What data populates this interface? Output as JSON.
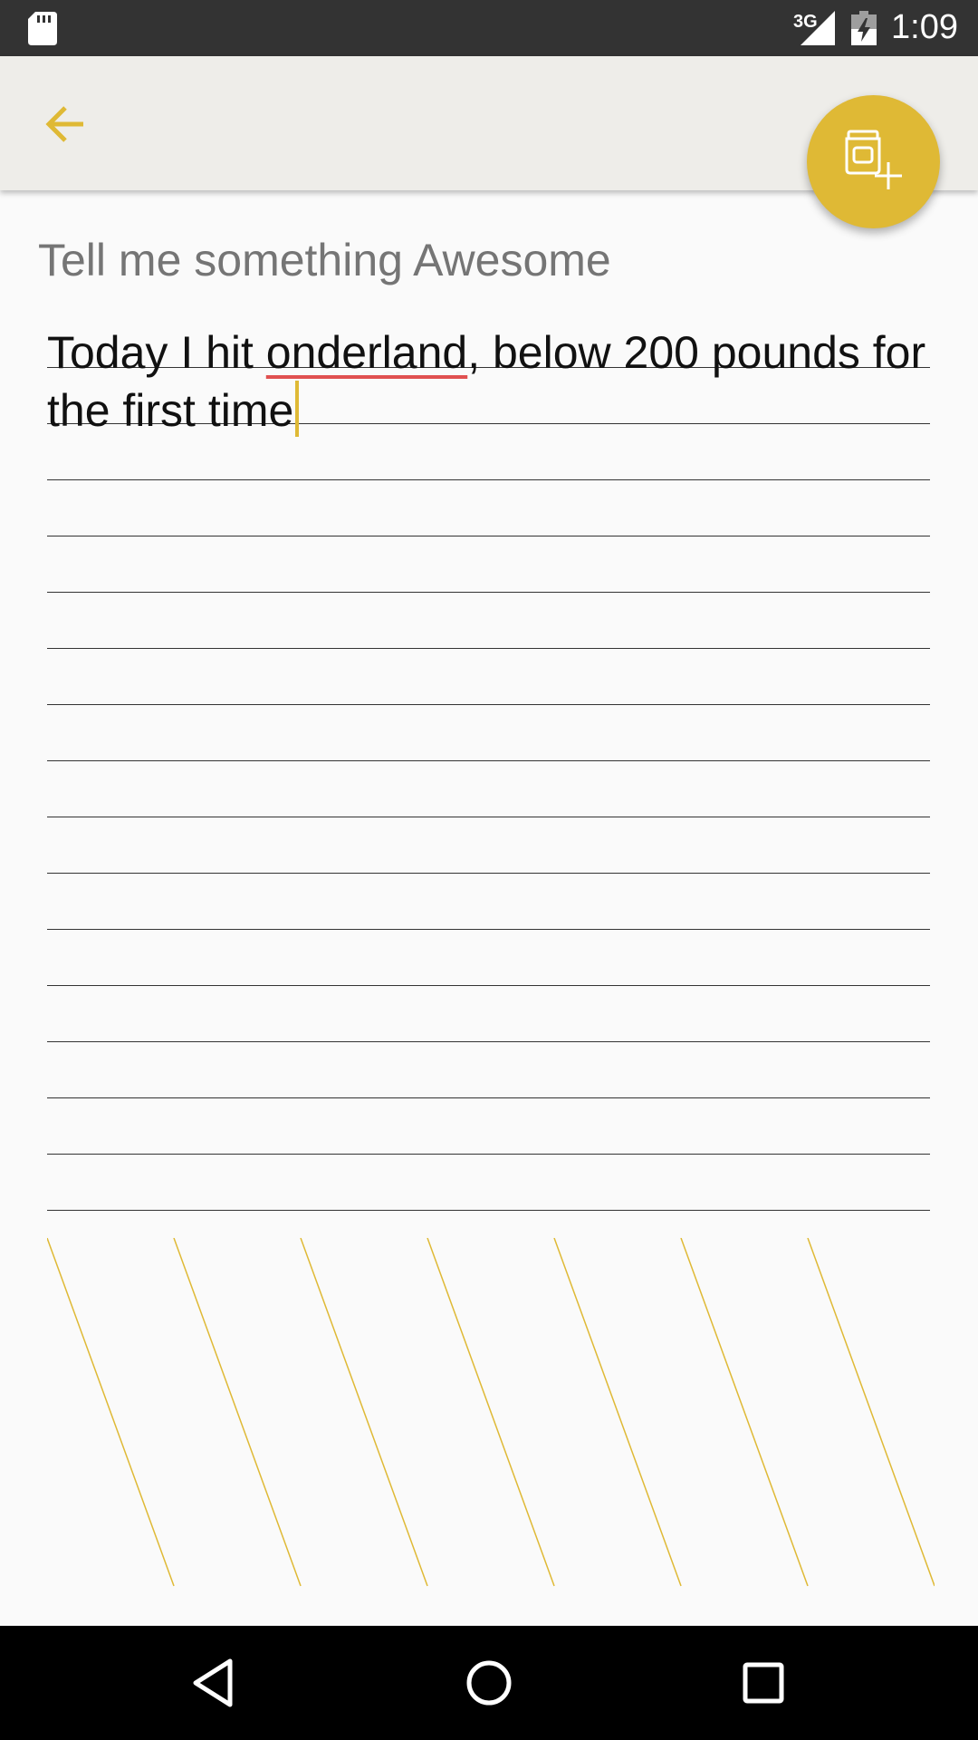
{
  "status_bar": {
    "network_type": "3G",
    "time": "1:09",
    "icons": [
      "sd-card-icon",
      "signal-icon",
      "battery-charging-icon"
    ]
  },
  "app_bar": {
    "back_icon": "arrow-back-icon",
    "fab_icon": "jar-add-icon"
  },
  "editor": {
    "prompt": "Tell me something Awesome",
    "text_before_misspelling": "Today I hit ",
    "misspelled_word": "onderland",
    "text_after_misspelling": ", below 200 pounds for the first time"
  },
  "nav_bar": {
    "icons": [
      "nav-back-icon",
      "nav-home-icon",
      "nav-recents-icon"
    ]
  },
  "colors": {
    "accent": "#dfb935",
    "app_bar_bg": "#eeede9",
    "status_bar_bg": "#333333",
    "page_bg": "#fafafa",
    "prompt_text": "#757575",
    "spellcheck_underline": "#e05050"
  }
}
